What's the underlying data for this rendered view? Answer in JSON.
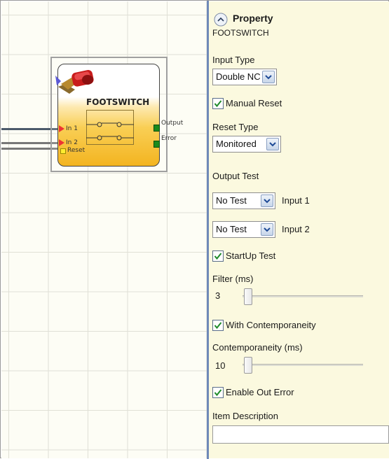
{
  "block": {
    "title": "FOOTSWITCH",
    "inputs": [
      "In 1",
      "In 2"
    ],
    "reset_pin": "Reset",
    "outputs": [
      "Output",
      "Error"
    ],
    "icon": "footswitch-pedal-icon"
  },
  "panel": {
    "header": "Property",
    "collapse_icon": "chevron-up-icon",
    "subtitle": "FOOTSWITCH",
    "input_type": {
      "label": "Input Type",
      "value": "Double NC"
    },
    "manual_reset": {
      "label": "Manual Reset",
      "checked": true
    },
    "reset_type": {
      "label": "Reset Type",
      "value": "Monitored"
    },
    "output_test": {
      "label": "Output Test",
      "rows": [
        {
          "value": "No Test",
          "input_label": "Input 1"
        },
        {
          "value": "No Test",
          "input_label": "Input 2"
        }
      ]
    },
    "startup_test": {
      "label": "StartUp Test",
      "checked": true
    },
    "filter": {
      "label": "Filter (ms)",
      "value": "3"
    },
    "with_contemporaneity": {
      "label": "With Contemporaneity",
      "checked": true
    },
    "contemporaneity": {
      "label": "Contemporaneity (ms)",
      "value": "10"
    },
    "enable_out_error": {
      "label": "Enable Out Error",
      "checked": true
    },
    "item_description": {
      "label": "Item Description",
      "value": ""
    }
  },
  "colors": {
    "panel_bg": "#fbf9df",
    "splitter": "#6f89b8",
    "block_gradient_bottom": "#f3b420",
    "output_led": "#1c8a1c",
    "input_arrow": "#ee3333",
    "reset_pin": "#ffec30"
  }
}
